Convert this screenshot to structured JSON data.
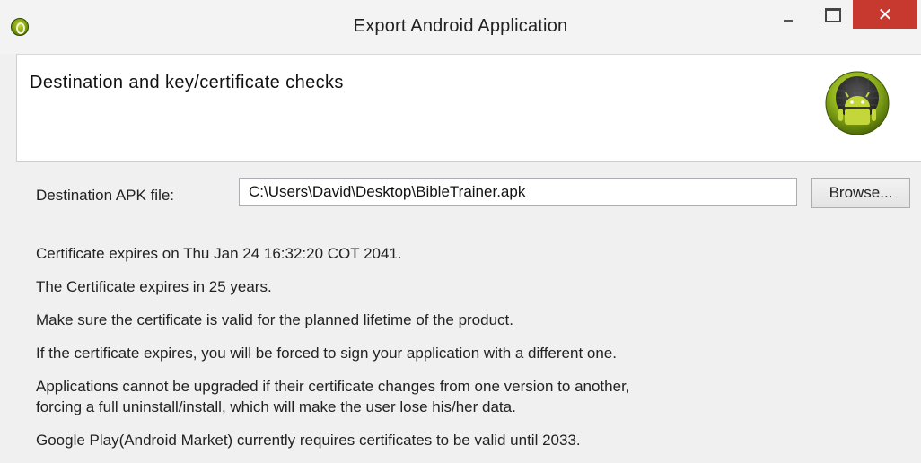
{
  "window": {
    "title": "Export Android Application",
    "controls": {
      "minimize": "minimize-icon",
      "maximize": "maximize-icon",
      "close": "close-icon"
    },
    "close_color": "#c7382e"
  },
  "header": {
    "title": "Destination and key/certificate checks",
    "logo": "android-logo"
  },
  "destination": {
    "label": "Destination APK file:",
    "value": "C:\\Users\\David\\Desktop\\BibleTrainer.apk",
    "browse_label": "Browse..."
  },
  "messages": [
    "Certificate expires on Thu Jan 24 16:32:20 COT 2041.",
    "The Certificate expires in 25 years.",
    "Make sure the certificate is valid for the planned lifetime of the product.",
    "If the certificate expires, you will be forced to sign your application with a different one.",
    "Applications cannot be upgraded if their certificate changes from one version to another,",
    "forcing a full uninstall/install, which will make the user lose his/her data.",
    "Google Play(Android Market) currently requires certificates to be valid until 2033."
  ]
}
